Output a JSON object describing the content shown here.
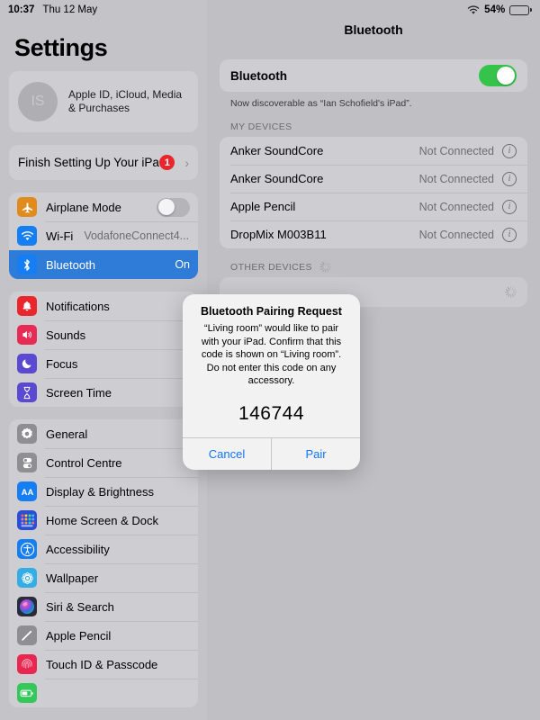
{
  "status_bar": {
    "time": "10:37",
    "date": "Thu 12 May",
    "wifi_icon": "wifi-icon",
    "battery_percent": "54%",
    "battery_level": 54
  },
  "sidebar": {
    "title": "Settings",
    "apple_id": {
      "initials": "IS",
      "line1": "Apple ID, iCloud, Media",
      "line2": "& Purchases"
    },
    "finish_setup": {
      "label": "Finish Setting Up Your iPad",
      "badge": "1",
      "chevron": "chevron-right-icon"
    },
    "groups": [
      {
        "items": [
          {
            "label": "Airplane Mode",
            "icon": "airplane-icon",
            "icon_color": "#e08b1c",
            "control": "toggle",
            "toggle_on": false
          },
          {
            "label": "Wi-Fi",
            "icon": "wifi-icon",
            "icon_color": "#157ef3",
            "value": "VodafoneConnect4...",
            "value_style": "inline"
          },
          {
            "label": "Bluetooth",
            "icon": "bluetooth-icon",
            "icon_color": "#157ef3",
            "value": "On",
            "selected": true
          }
        ]
      },
      {
        "items": [
          {
            "label": "Notifications",
            "icon": "bell-icon",
            "icon_color": "#e8262b"
          },
          {
            "label": "Sounds",
            "icon": "speaker-icon",
            "icon_color": "#e62b54"
          },
          {
            "label": "Focus",
            "icon": "moon-icon",
            "icon_color": "#5a4ad1"
          },
          {
            "label": "Screen Time",
            "icon": "hourglass-icon",
            "icon_color": "#5a4ad1"
          }
        ]
      },
      {
        "items": [
          {
            "label": "General",
            "icon": "gear-icon",
            "icon_color": "#8e8e93"
          },
          {
            "label": "Control Centre",
            "icon": "sliders-icon",
            "icon_color": "#8e8e93"
          },
          {
            "label": "Display & Brightness",
            "icon": "text-size-icon",
            "icon_color": "#157ef3"
          },
          {
            "label": "Home Screen & Dock",
            "icon": "app-grid-icon",
            "icon_color": "#2b4ed6"
          },
          {
            "label": "Accessibility",
            "icon": "accessibility-icon",
            "icon_color": "#157ef3"
          },
          {
            "label": "Wallpaper",
            "icon": "wallpaper-icon",
            "icon_color": "#32ade6"
          },
          {
            "label": "Siri & Search",
            "icon": "siri-icon",
            "icon_color": "#2a2a3a"
          },
          {
            "label": "Apple Pencil",
            "icon": "pencil-icon",
            "icon_color": "#8e8e93"
          },
          {
            "label": "Touch ID & Passcode",
            "icon": "fingerprint-icon",
            "icon_color": "#e8264f"
          },
          {
            "label": "",
            "icon": "battery-green-icon",
            "icon_color": "#34c759"
          }
        ]
      }
    ]
  },
  "detail": {
    "title": "Bluetooth",
    "bluetooth_label": "Bluetooth",
    "bluetooth_on": true,
    "discoverable_note": "Now discoverable as “Ian Schofield's iPad”.",
    "my_devices_header": "MY DEVICES",
    "devices": [
      {
        "name": "Anker SoundCore",
        "state": "Not Connected",
        "info": "info-icon"
      },
      {
        "name": "Anker SoundCore",
        "state": "Not Connected",
        "info": "info-icon"
      },
      {
        "name": "Apple Pencil",
        "state": "Not Connected",
        "info": "info-icon"
      },
      {
        "name": "DropMix M003B11",
        "state": "Not Connected",
        "info": "info-icon"
      }
    ],
    "other_devices_header": "OTHER DEVICES",
    "scanning_spinner": "activity-spinner-icon"
  },
  "modal": {
    "title": "Bluetooth Pairing Request",
    "message": "“Living room” would like to pair with your iPad. Confirm that this code is shown on “Living room”. Do not enter this code on any accessory.",
    "code": "146744",
    "cancel_label": "Cancel",
    "pair_label": "Pair"
  },
  "colors": {
    "accent_blue": "#1175f0",
    "selection_blue": "#2f7bd8",
    "toggle_green": "#36c34c",
    "badge_red": "#e8262b"
  }
}
